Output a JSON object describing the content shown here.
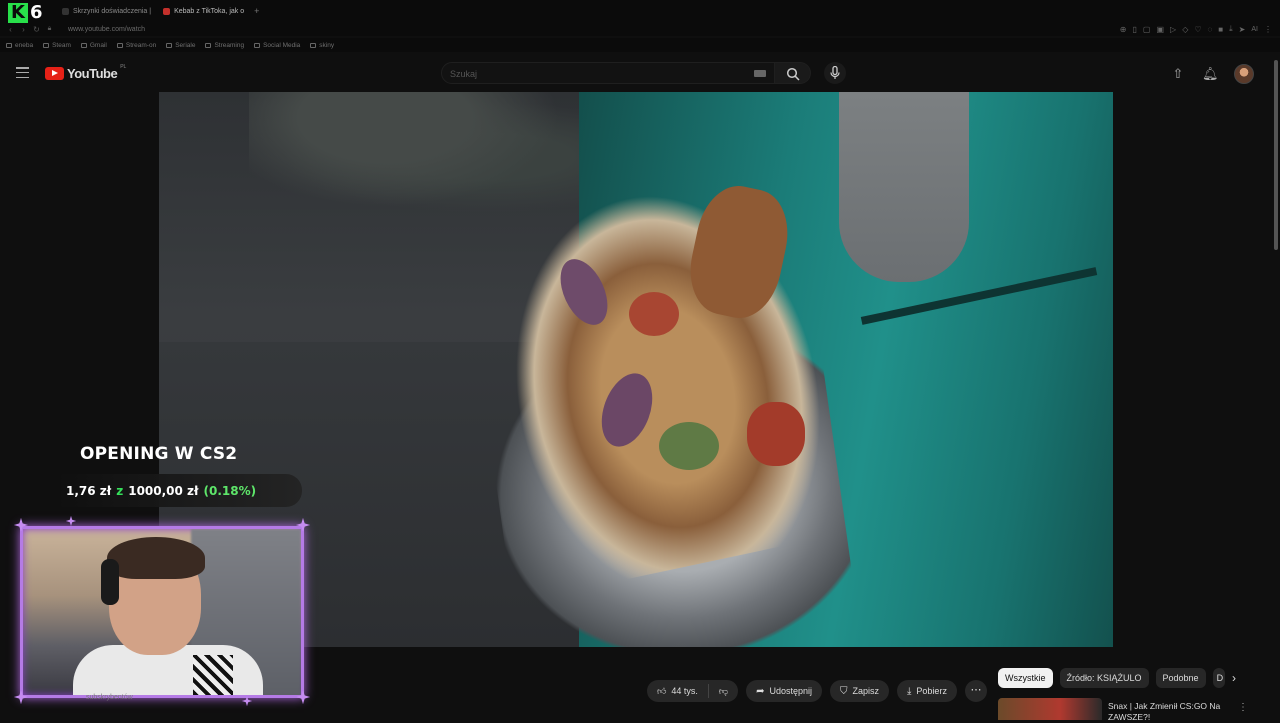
{
  "browser": {
    "tabs": [
      {
        "label": "Skrzynki doświadczenia |",
        "active": false
      },
      {
        "label": "Kebab z TikToka, jak o",
        "active": true
      }
    ],
    "new_tab_symbol": "+",
    "url": "www.youtube.com/watch",
    "ext_ai_label": "AI",
    "bookmarks": [
      "eneba",
      "Steam",
      "Gmail",
      "Stream-on",
      "Seriale",
      "Streaming",
      "Social Media",
      "skiny"
    ]
  },
  "overlay_logo": {
    "letter": "K",
    "digit": "6"
  },
  "youtube": {
    "logo_text": "YouTube",
    "country_code": "PL",
    "search_placeholder": "Szukaj"
  },
  "stream_overlay": {
    "title": "OPENING W CS2",
    "amount_current": "1,76 zł",
    "connector": "z",
    "amount_total": "1000,00 zł",
    "percent": "(0.18%)"
  },
  "actions": {
    "likes": "44 tys.",
    "share": "Udostępnij",
    "save": "Zapisz",
    "download": "Pobierz",
    "more": "⋯"
  },
  "chips": {
    "items": [
      "Wszystkie",
      "Źródło: KSIĄŻULO",
      "Podobne",
      "D"
    ],
    "active_index": 0
  },
  "recommendation": {
    "title": "Snax | Jak Zmienił CS:GO Na ZAWSZE?!"
  },
  "channel_sub": "subskrybentów",
  "colors": {
    "brand_red": "#e62117",
    "overlay_green": "#35e05a",
    "cam_frame_purple": "#b57be6"
  }
}
